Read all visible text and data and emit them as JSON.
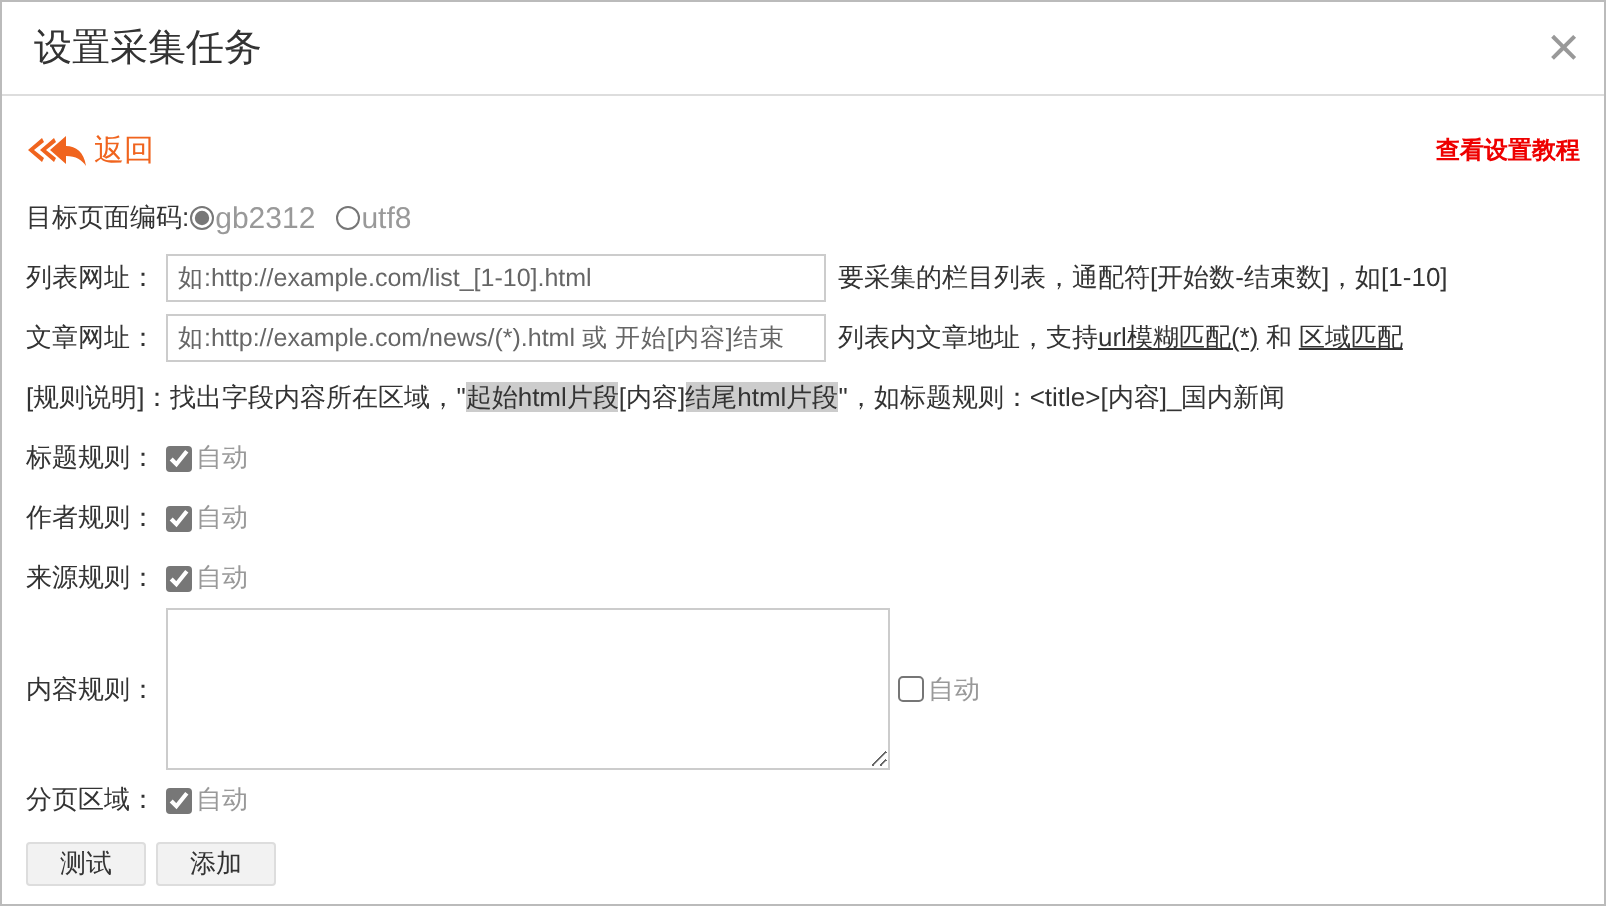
{
  "dialog": {
    "title": "设置采集任务",
    "close_icon": "×"
  },
  "back_link": {
    "label": "返回"
  },
  "tutorial_link": {
    "label": "查看设置教程"
  },
  "encoding": {
    "label": "目标页面编码:",
    "options": [
      {
        "label": "gb2312",
        "selected": true
      },
      {
        "label": "utf8",
        "selected": false
      }
    ]
  },
  "list_url": {
    "label": "列表网址：",
    "placeholder": "如:http://example.com/list_[1-10].html",
    "hint": "要采集的栏目列表，通配符[开始数-结束数]，如[1-10]"
  },
  "article_url": {
    "label": "文章网址：",
    "placeholder": "如:http://example.com/news/(*).html 或 开始[内容]结束",
    "hint_parts": [
      {
        "kind": "text",
        "text": "列表内文章地址，支持"
      },
      {
        "kind": "link",
        "text": "url模糊匹配(*)"
      },
      {
        "kind": "text",
        "text": " 和 "
      },
      {
        "kind": "link",
        "text": "区域匹配"
      }
    ]
  },
  "rule_note": {
    "parts": [
      {
        "text": "[规则说明]：找出字段内容所在区域，\"",
        "highlighted": false
      },
      {
        "text": "起始html片段",
        "highlighted": true
      },
      {
        "text": "[内容]",
        "highlighted": false
      },
      {
        "text": "结尾html片段",
        "highlighted": true
      },
      {
        "text": "\"，如标题规则：<title>[内容]_国内新闻",
        "highlighted": false
      }
    ]
  },
  "rules": [
    {
      "kind": "checkbox",
      "label": "标题规则：",
      "auto_label": "自动",
      "checked": true
    },
    {
      "kind": "checkbox",
      "label": "作者规则：",
      "auto_label": "自动",
      "checked": true
    },
    {
      "kind": "checkbox",
      "label": "来源规则：",
      "auto_label": "自动",
      "checked": true
    },
    {
      "kind": "textarea",
      "label": "内容规则：",
      "auto_label": "自动",
      "checked": false
    },
    {
      "kind": "checkbox",
      "label": "分页区域：",
      "auto_label": "自动",
      "checked": true
    }
  ],
  "buttons": [
    {
      "label": "测试"
    },
    {
      "label": "添加"
    }
  ]
}
